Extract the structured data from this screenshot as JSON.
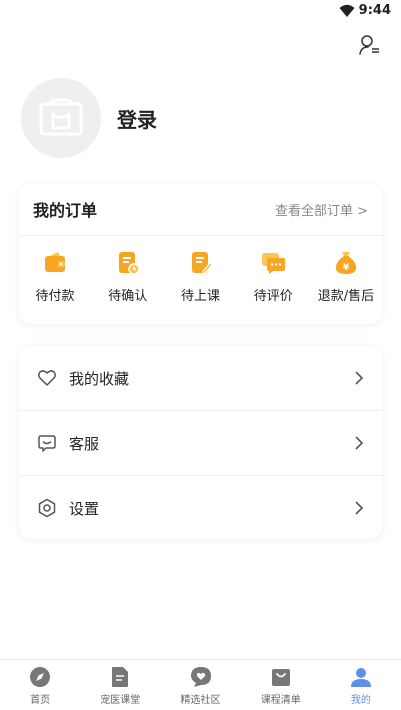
{
  "status_bar": {
    "time": "9:44"
  },
  "profile": {
    "login_label": "登录"
  },
  "orders": {
    "title": "我的订单",
    "view_all": "查看全部订单 >",
    "items": [
      {
        "label": "待付款",
        "icon": "wallet-icon"
      },
      {
        "label": "待确认",
        "icon": "pending-confirm-icon"
      },
      {
        "label": "待上课",
        "icon": "document-edit-icon"
      },
      {
        "label": "待评价",
        "icon": "chat-icon"
      },
      {
        "label": "退款/售后",
        "icon": "money-bag-icon"
      }
    ]
  },
  "menu": {
    "items": [
      {
        "label": "我的收藏",
        "icon": "heart-icon"
      },
      {
        "label": "客服",
        "icon": "customer-service-icon"
      },
      {
        "label": "设置",
        "icon": "settings-icon"
      }
    ]
  },
  "bottom_nav": {
    "items": [
      {
        "label": "首页",
        "icon": "compass-icon"
      },
      {
        "label": "宠医课堂",
        "icon": "book-icon"
      },
      {
        "label": "精选社区",
        "icon": "community-icon"
      },
      {
        "label": "课程清单",
        "icon": "bag-icon"
      },
      {
        "label": "我的",
        "icon": "user-icon"
      }
    ],
    "active_index": 4
  },
  "colors": {
    "accent_orange": "#f6a623",
    "active_blue": "#5f8fe8",
    "inactive_gray": "#888888"
  }
}
